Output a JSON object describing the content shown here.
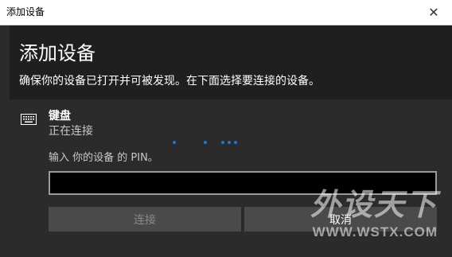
{
  "window": {
    "title": "添加设备",
    "close_glyph": "✕"
  },
  "main": {
    "heading": "添加设备",
    "subtitle": "确保你的设备已打开并可被发现。在下面选择要连接的设备。"
  },
  "device": {
    "icon": "keyboard-icon",
    "name": "键盘",
    "status": "正在连接",
    "pin_prompt": "输入 你的设备 的 PIN。",
    "pin_value": "",
    "connect_label": "连接",
    "cancel_label": "取消"
  },
  "colors": {
    "accent_dots": "#1a7ad4",
    "background": "#1f1f1f",
    "panel": "#2b2b2b"
  },
  "watermark": {
    "chinese": "外设天下",
    "url": "WWW.WSTX.COM"
  }
}
